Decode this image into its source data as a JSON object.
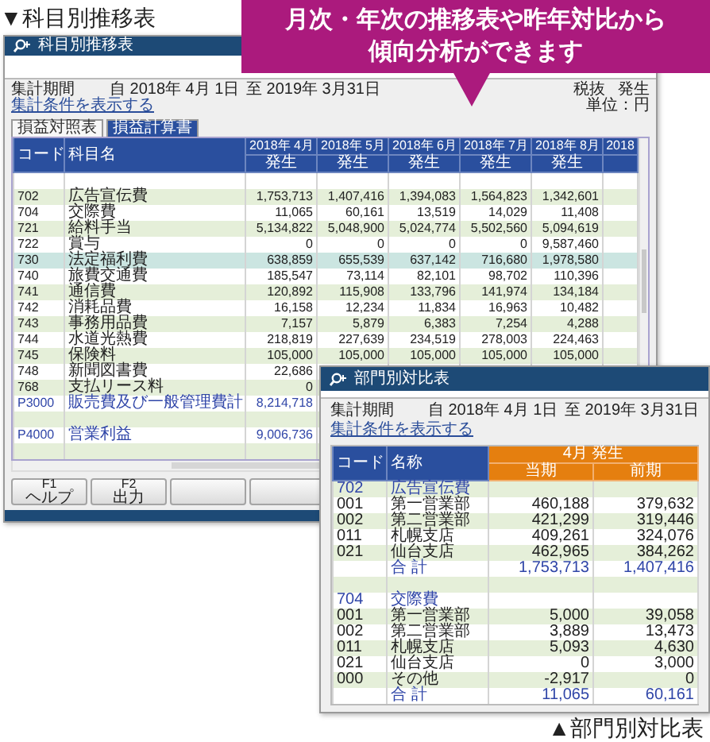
{
  "heading": "▼科目別推移表",
  "callout": {
    "lines": [
      "月次・年次の推移表や昨年対比から",
      "傾向分析ができます"
    ]
  },
  "trend_window": {
    "title": "科目別推移表",
    "period_label": "集計期間",
    "from": "自 2018年 4月 1日",
    "to": "至 2019年 3月31日",
    "tax": "税抜",
    "basis": "発生",
    "unit": "単位：円",
    "link": "集計条件を表示する",
    "tabs": [
      {
        "label": "損益対照表",
        "selected": false
      },
      {
        "label": "損益計算書",
        "selected": true
      }
    ],
    "columns": [
      "コード",
      "科目名"
    ],
    "months": [
      {
        "label": "2018年 4月",
        "sub": "発生"
      },
      {
        "label": "2018年 5月",
        "sub": "発生"
      },
      {
        "label": "2018年 6月",
        "sub": "発生"
      },
      {
        "label": "2018年 7月",
        "sub": "発生"
      },
      {
        "label": "2018年 8月",
        "sub": "発生"
      }
    ],
    "cut_column": "2018",
    "rows": [
      {
        "kind": "blank"
      },
      {
        "kind": "item",
        "code": "702",
        "name": "広告宣伝費",
        "values": [
          "1,753,713",
          "1,407,416",
          "1,394,083",
          "1,564,823",
          "1,342,601"
        ],
        "selected": false
      },
      {
        "kind": "item",
        "code": "704",
        "name": "交際費",
        "values": [
          "11,065",
          "60,161",
          "13,519",
          "14,029",
          "11,408"
        ],
        "selected": false
      },
      {
        "kind": "item",
        "code": "721",
        "name": "給料手当",
        "values": [
          "5,134,822",
          "5,048,900",
          "5,024,774",
          "5,502,560",
          "5,094,619"
        ],
        "selected": false
      },
      {
        "kind": "item",
        "code": "722",
        "name": "賞与",
        "values": [
          "0",
          "0",
          "0",
          "0",
          "9,587,460"
        ],
        "selected": false
      },
      {
        "kind": "item",
        "code": "730",
        "name": "法定福利費",
        "values": [
          "638,859",
          "655,539",
          "637,142",
          "716,680",
          "1,978,580"
        ],
        "selected": true
      },
      {
        "kind": "item",
        "code": "740",
        "name": "旅費交通費",
        "values": [
          "185,547",
          "73,114",
          "82,101",
          "98,702",
          "110,396"
        ],
        "selected": false
      },
      {
        "kind": "item",
        "code": "741",
        "name": "通信費",
        "values": [
          "120,892",
          "115,908",
          "133,796",
          "141,974",
          "134,184"
        ],
        "selected": false
      },
      {
        "kind": "item",
        "code": "742",
        "name": "消耗品費",
        "values": [
          "16,158",
          "12,234",
          "11,834",
          "16,963",
          "10,482"
        ],
        "selected": false
      },
      {
        "kind": "item",
        "code": "743",
        "name": "事務用品費",
        "values": [
          "7,157",
          "5,879",
          "6,383",
          "7,254",
          "4,288"
        ],
        "selected": false
      },
      {
        "kind": "item",
        "code": "744",
        "name": "水道光熱費",
        "values": [
          "218,819",
          "227,639",
          "234,519",
          "278,003",
          "224,463"
        ],
        "selected": false
      },
      {
        "kind": "item",
        "code": "745",
        "name": "保険料",
        "values": [
          "105,000",
          "105,000",
          "105,000",
          "105,000",
          "105,000"
        ],
        "selected": false
      },
      {
        "kind": "item",
        "code": "748",
        "name": "新聞図書費",
        "values": [
          "22,686"
        ],
        "selected": false
      },
      {
        "kind": "item",
        "code": "768",
        "name": "支払リース料",
        "values": [
          "0"
        ],
        "selected": false
      },
      {
        "kind": "total",
        "code": "P3000",
        "name": "販売費及び一般管理費計",
        "values": [
          "8,214,718"
        ],
        "selected": false
      },
      {
        "kind": "blank"
      },
      {
        "kind": "total",
        "code": "P4000",
        "name": "営業利益",
        "values": [
          "9,006,736"
        ],
        "selected": false
      },
      {
        "kind": "blank"
      }
    ],
    "function_keys": [
      {
        "kind": "labeled",
        "key": "F1",
        "label": "ヘルプ"
      },
      {
        "kind": "labeled",
        "key": "F2",
        "label": "出力"
      },
      {
        "kind": "blank"
      },
      {
        "kind": "blank"
      }
    ]
  },
  "dept_window": {
    "title": "部門別対比表",
    "period_label": "集計期間",
    "from": "自 2018年 4月 1日",
    "to": "至 2019年 3月31日",
    "link": "集計条件を表示する",
    "columns": [
      "コード",
      "名称"
    ],
    "group_header": "4月 発生",
    "sub_columns": [
      "当期",
      "前期"
    ],
    "rows": [
      {
        "kind": "group",
        "code": "702",
        "name": "広告宣伝費"
      },
      {
        "kind": "item",
        "code": "001",
        "name": "第一営業部",
        "values": [
          "460,188",
          "379,632"
        ]
      },
      {
        "kind": "item",
        "code": "002",
        "name": "第二営業部",
        "values": [
          "421,299",
          "319,446"
        ]
      },
      {
        "kind": "item",
        "code": "011",
        "name": "札幌支店",
        "values": [
          "409,261",
          "324,076"
        ]
      },
      {
        "kind": "item",
        "code": "021",
        "name": "仙台支店",
        "values": [
          "462,965",
          "384,262"
        ]
      },
      {
        "kind": "total",
        "name": "合 計",
        "values": [
          "1,753,713",
          "1,407,416"
        ]
      },
      {
        "kind": "blank"
      },
      {
        "kind": "group",
        "code": "704",
        "name": "交際費"
      },
      {
        "kind": "item",
        "code": "001",
        "name": "第一営業部",
        "values": [
          "5,000",
          "39,058"
        ]
      },
      {
        "kind": "item",
        "code": "002",
        "name": "第二営業部",
        "values": [
          "3,889",
          "13,473"
        ]
      },
      {
        "kind": "item",
        "code": "011",
        "name": "札幌支店",
        "values": [
          "5,093",
          "4,630"
        ]
      },
      {
        "kind": "item",
        "code": "021",
        "name": "仙台支店",
        "values": [
          "0",
          "3,000"
        ]
      },
      {
        "kind": "item",
        "code": "000",
        "name": "その他",
        "values": [
          "-2,917",
          "0"
        ]
      },
      {
        "kind": "total",
        "name": "合 計",
        "values": [
          "11,065",
          "60,161"
        ]
      }
    ]
  },
  "footer": "▲部門別対比表"
}
